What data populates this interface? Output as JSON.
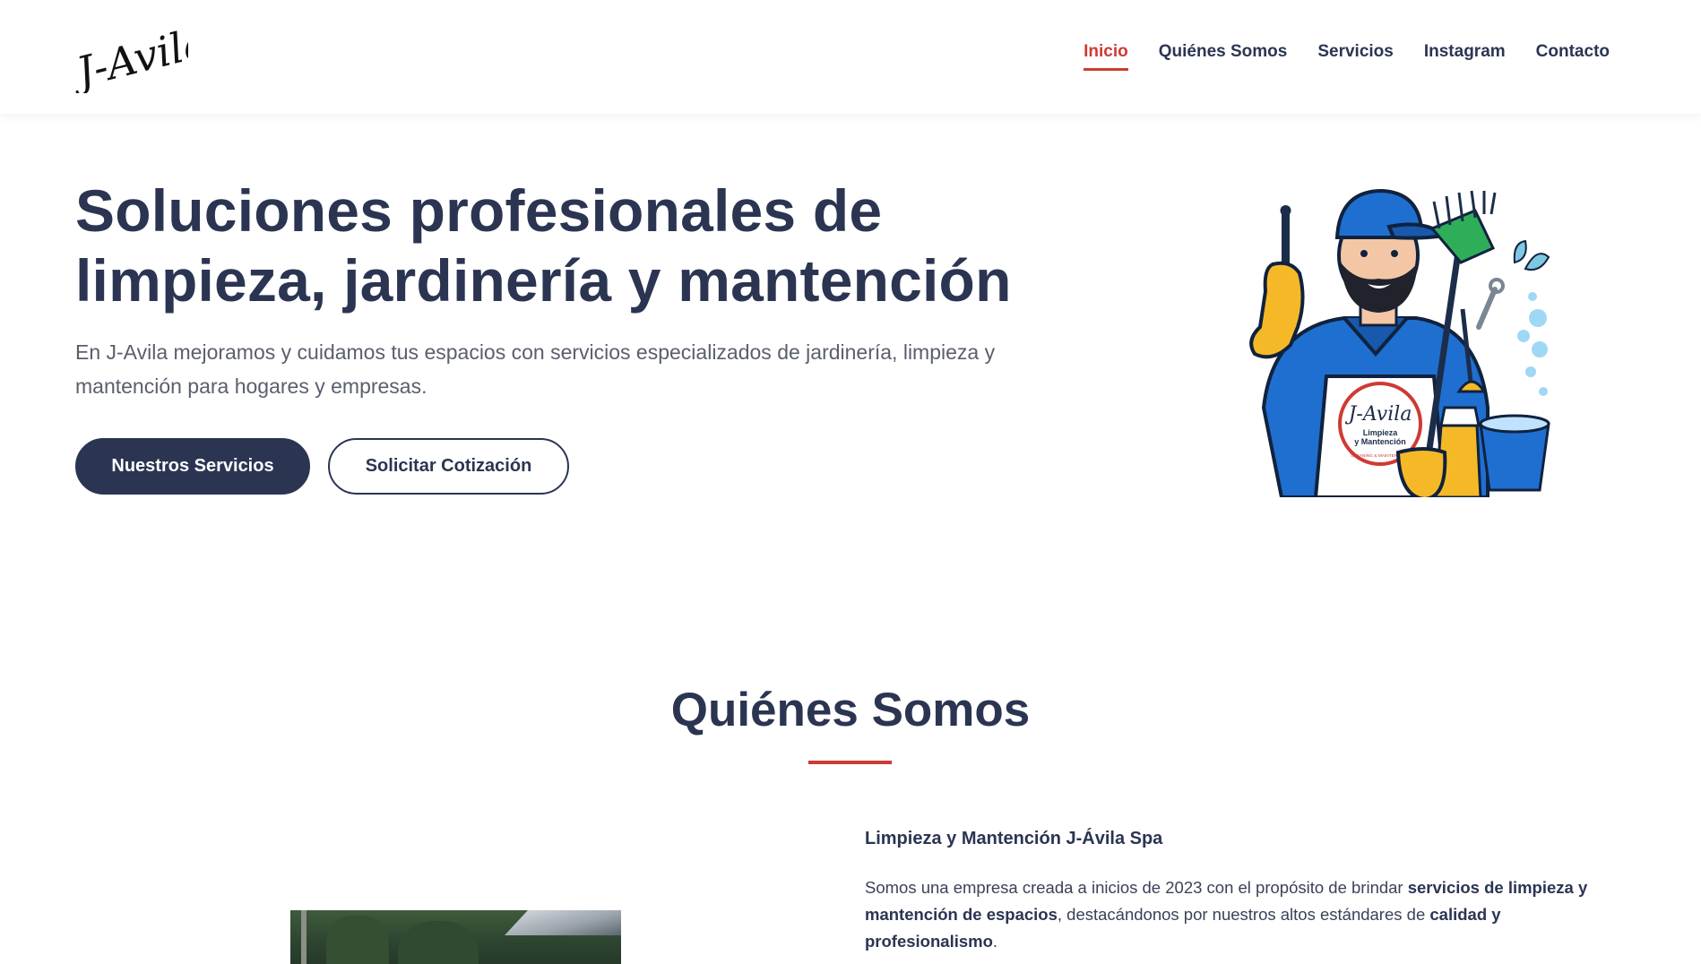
{
  "brand": {
    "logo_text": "J-Avila"
  },
  "nav": {
    "items": [
      {
        "label": "Inicio",
        "active": true
      },
      {
        "label": "Quiénes Somos",
        "active": false
      },
      {
        "label": "Servicios",
        "active": false
      },
      {
        "label": "Instagram",
        "active": false
      },
      {
        "label": "Contacto",
        "active": false
      }
    ]
  },
  "hero": {
    "title_line1": "Soluciones profesionales de",
    "title_line2": "limpieza, jardinería y mantención",
    "subtitle": "En J-Avila mejoramos y cuidamos tus espacios con servicios especializados de jardinería, limpieza y mantención para hogares y empresas.",
    "primary_button": "Nuestros Servicios",
    "secondary_button": "Solicitar Cotización",
    "apron_logo_text": "J-Avila",
    "apron_sub1": "Limpieza",
    "apron_sub2": "y Mantención",
    "apron_ring": "CLEANING & MAINTENANCE"
  },
  "about": {
    "title": "Quiénes Somos",
    "heading": "Limpieza y Mantención J-Ávila Spa",
    "text_1": "Somos una empresa creada a inicios de 2023 con el propósito de brindar ",
    "text_bold_1": "servicios de limpieza y mantención de espacios",
    "text_2": ", destacándonos por nuestros altos estándares de ",
    "text_bold_2": "calidad y profesionalismo",
    "text_3": "."
  },
  "colors": {
    "navy": "#2b3552",
    "accent_red": "#cf3a34",
    "text_gray": "#5a5f6d",
    "blue": "#1f6fd1",
    "yellow": "#f5b928"
  }
}
